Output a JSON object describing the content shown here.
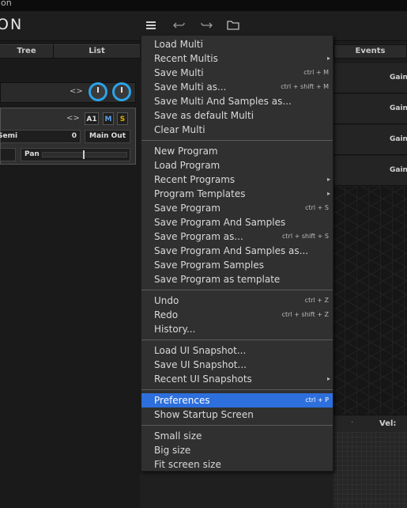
{
  "window": {
    "title_fragment": "ion"
  },
  "app": {
    "brand": "ON"
  },
  "toolbar": {
    "menu_icon": "hamburger-icon",
    "undo_icon": "undo-icon",
    "redo_icon": "redo-icon",
    "folder_icon": "folder-icon"
  },
  "left": {
    "tabs": [
      "Tree",
      "List"
    ],
    "arrows": "<>",
    "prog_arrows": "<>",
    "part": "A1",
    "mute": "M",
    "solo": "S",
    "semi_label": "Semi",
    "semi_value": "0",
    "output": "Main Out",
    "pan_label": "Pan"
  },
  "right": {
    "events_tab": "Events",
    "gain_labels": [
      "Gain",
      "Gain",
      "Gain",
      "Gain"
    ],
    "vel_label": "Vel:",
    "vel_dot": "·"
  },
  "menu": {
    "groups": [
      [
        {
          "label": "Load Multi",
          "shortcut": "",
          "submenu": false
        },
        {
          "label": "Recent Multis",
          "shortcut": "",
          "submenu": true
        },
        {
          "label": "Save Multi",
          "shortcut": "ctrl + M",
          "submenu": false
        },
        {
          "label": "Save Multi as...",
          "shortcut": "ctrl + shift + M",
          "submenu": false
        },
        {
          "label": "Save Multi And Samples as...",
          "shortcut": "",
          "submenu": false
        },
        {
          "label": "Save as default Multi",
          "shortcut": "",
          "submenu": false
        },
        {
          "label": "Clear Multi",
          "shortcut": "",
          "submenu": false
        }
      ],
      [
        {
          "label": "New Program",
          "shortcut": "",
          "submenu": false
        },
        {
          "label": "Load Program",
          "shortcut": "",
          "submenu": false
        },
        {
          "label": "Recent Programs",
          "shortcut": "",
          "submenu": true
        },
        {
          "label": "Program Templates",
          "shortcut": "",
          "submenu": true
        },
        {
          "label": "Save Program",
          "shortcut": "ctrl + S",
          "submenu": false
        },
        {
          "label": "Save Program And Samples",
          "shortcut": "",
          "submenu": false
        },
        {
          "label": "Save Program as...",
          "shortcut": "ctrl + shift + S",
          "submenu": false
        },
        {
          "label": "Save Program And Samples as...",
          "shortcut": "",
          "submenu": false
        },
        {
          "label": "Save Program Samples",
          "shortcut": "",
          "submenu": false
        },
        {
          "label": "Save Program as template",
          "shortcut": "",
          "submenu": false
        }
      ],
      [
        {
          "label": "Undo",
          "shortcut": "ctrl + Z",
          "submenu": false
        },
        {
          "label": "Redo",
          "shortcut": "ctrl + shift + Z",
          "submenu": false
        },
        {
          "label": "History...",
          "shortcut": "",
          "submenu": false
        }
      ],
      [
        {
          "label": "Load UI Snapshot...",
          "shortcut": "",
          "submenu": false
        },
        {
          "label": "Save UI Snapshot...",
          "shortcut": "",
          "submenu": false
        },
        {
          "label": "Recent UI Snapshots",
          "shortcut": "",
          "submenu": true
        }
      ],
      [
        {
          "label": "Preferences",
          "shortcut": "ctrl + P",
          "submenu": false,
          "highlighted": true
        },
        {
          "label": "Show Startup Screen",
          "shortcut": "",
          "submenu": false
        }
      ],
      [
        {
          "label": "Small size",
          "shortcut": "",
          "submenu": false
        },
        {
          "label": "Big size",
          "shortcut": "",
          "submenu": false
        },
        {
          "label": "Fit screen size",
          "shortcut": "",
          "submenu": false
        }
      ]
    ],
    "submenu_arrow": "▸",
    "highlight_color": "#2d6fdc"
  },
  "colors": {
    "accent": "#2ba3e8",
    "solo": "#e0b000",
    "mute": "#5aa0e8"
  }
}
